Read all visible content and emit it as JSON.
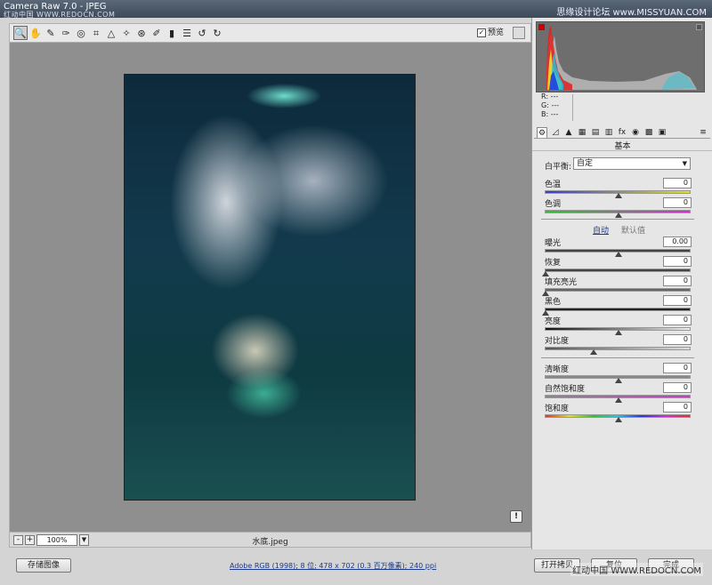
{
  "window": {
    "title": "Camera Raw 7.0  -  JPEG",
    "watermark_left": "红动中国 WWW.REDOCN.COM",
    "watermark_right": "思缘设计论坛 www.MISSYUAN.COM"
  },
  "toolbar": {
    "tools": [
      {
        "name": "zoom-tool",
        "glyph": "🔍"
      },
      {
        "name": "hand-tool",
        "glyph": "✋"
      },
      {
        "name": "white-balance-tool",
        "glyph": "✎"
      },
      {
        "name": "color-sampler-tool",
        "glyph": "✑"
      },
      {
        "name": "targeted-adjustment-tool",
        "glyph": "◎"
      },
      {
        "name": "crop-tool",
        "glyph": "⌗"
      },
      {
        "name": "straighten-tool",
        "glyph": "△"
      },
      {
        "name": "spot-removal-tool",
        "glyph": "✧"
      },
      {
        "name": "red-eye-tool",
        "glyph": "⊛"
      },
      {
        "name": "adjustment-brush-tool",
        "glyph": "✐"
      },
      {
        "name": "graduated-filter-tool",
        "glyph": "▮"
      },
      {
        "name": "preferences-tool",
        "glyph": "☰"
      },
      {
        "name": "rotate-ccw-tool",
        "glyph": "↺"
      },
      {
        "name": "rotate-cw-tool",
        "glyph": "↻"
      }
    ],
    "preview_label": "预览",
    "preview_checked": "✓"
  },
  "status": {
    "zoom_minus": "-",
    "zoom_plus": "+",
    "zoom_value": "100%",
    "zoom_dropdown": "▼",
    "filename": "水底.jpeg",
    "notice": "!"
  },
  "bottom": {
    "save_label": "存储图像",
    "info_text": "Adobe RGB (1998); 8 位; 478 x 702 (0.3 百万像素); 240 ppi",
    "open_label": "打开拷贝",
    "reset_label": "复位",
    "done_label": "完成",
    "watermark": "红动中国 WWW.REDOCN.COM"
  },
  "panel": {
    "rgb": {
      "r": "R:  ---",
      "g": "G:  ---",
      "b": "B:  ---"
    },
    "tabs": [
      "⚙",
      "◿",
      "▲",
      "▦",
      "▤",
      "▥",
      "fx",
      "◉",
      "▩",
      "▣"
    ],
    "menu": "≡",
    "section_title": "基本",
    "white_balance_label": "白平衡:",
    "white_balance_value": "自定",
    "auto_label": "自动",
    "default_label": "默认值",
    "sliders": [
      {
        "label": "色温",
        "value": "0",
        "level": 0.5
      },
      {
        "label": "色调",
        "value": "0",
        "level": 0.5
      },
      {
        "label": "曝光",
        "value": "0.00",
        "level": 0.5
      },
      {
        "label": "恢复",
        "value": "0",
        "level": 0.0
      },
      {
        "label": "填充亮光",
        "value": "0",
        "level": 0.0
      },
      {
        "label": "黑色",
        "value": "0",
        "level": 0.0
      },
      {
        "label": "亮度",
        "value": "0",
        "level": 0.5
      },
      {
        "label": "对比度",
        "value": "0",
        "level": 0.33
      },
      {
        "label": "清晰度",
        "value": "0",
        "level": 0.5
      },
      {
        "label": "自然饱和度",
        "value": "0",
        "level": 0.5
      },
      {
        "label": "饱和度",
        "value": "0",
        "level": 0.5
      }
    ]
  },
  "colors": {
    "accent_link": "#1a3a8a",
    "clip_warning": "#cc0000"
  }
}
